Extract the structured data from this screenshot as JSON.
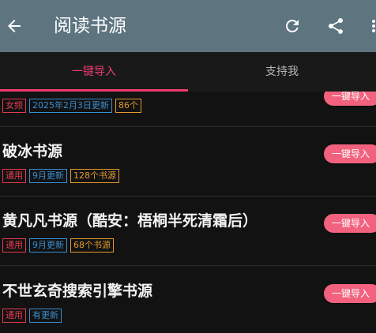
{
  "appbar": {
    "title": "阅读书源",
    "icons": [
      "back-arrow-icon",
      "refresh-icon",
      "share-icon",
      "more-vert-icon"
    ],
    "color": "#5e7580"
  },
  "tabs": [
    {
      "label": "一键导入",
      "active": true
    },
    {
      "label": "支持我",
      "active": false
    }
  ],
  "colors": {
    "accent": "#ef3a6e",
    "button": "#f2627e",
    "tag_red": "#e53a4f",
    "tag_blue": "#3a8ed0",
    "tag_orange": "#e39b2e"
  },
  "items": [
    {
      "name": "",
      "tags": [
        "女频",
        "2025年2月3日更新",
        "86个"
      ],
      "button": "一键导入"
    },
    {
      "name": "破冰书源",
      "tags": [
        "通用",
        "9月更新",
        "128个书源"
      ],
      "button": "一键导入"
    },
    {
      "name": "黄凡凡书源（酷安：梧桐半死清霜后）",
      "tags": [
        "通用",
        "9月更新",
        "68个书源"
      ],
      "button": "一键导入"
    },
    {
      "name": "不世玄奇搜索引擎书源",
      "tags": [
        "通用",
        "有更新"
      ],
      "button": "一键导入"
    }
  ]
}
